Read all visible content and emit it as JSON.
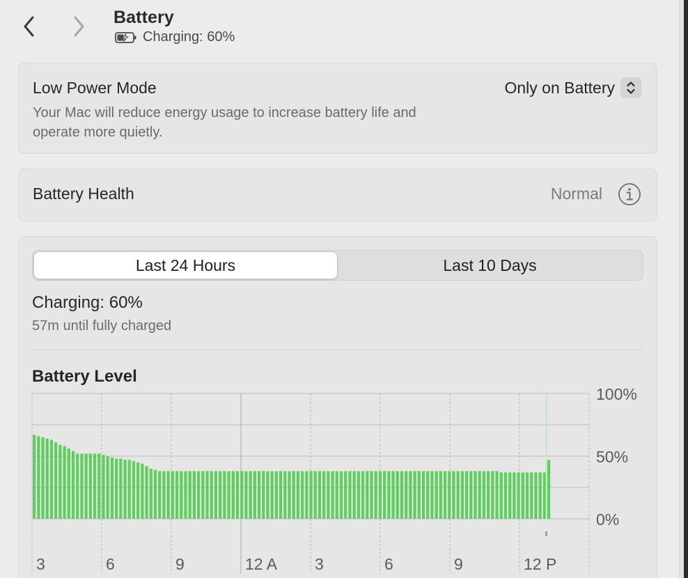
{
  "header": {
    "title": "Battery",
    "subtitle": "Charging: 60%",
    "back_icon": "chevron-left-icon",
    "forward_icon": "chevron-right-icon",
    "battery_icon": "battery-charging-icon"
  },
  "low_power_mode": {
    "title": "Low Power Mode",
    "description": "Your Mac will reduce energy usage to increase battery life and operate more quietly.",
    "selected_option": "Only on Battery"
  },
  "battery_health": {
    "label": "Battery Health",
    "value": "Normal",
    "info_icon": "info-circle-icon"
  },
  "usage": {
    "tabs": [
      {
        "label": "Last 24 Hours",
        "active": true
      },
      {
        "label": "Last 10 Days",
        "active": false
      }
    ],
    "status": "Charging: 60%",
    "time_remaining": "57m until fully charged"
  },
  "colors": {
    "bar_green": "#5fce5f",
    "charging_marker": "#bfe8bf"
  },
  "chart_data": {
    "type": "bar",
    "title": "Battery Level",
    "y_tick_labels": [
      "100%",
      "50%",
      "0%"
    ],
    "ylim": [
      0,
      100
    ],
    "x_tick_labels": [
      "3",
      "6",
      "9",
      "12 A",
      "3",
      "6",
      "9",
      "12 P"
    ],
    "grid": true,
    "values": [
      67,
      66,
      65,
      64,
      63,
      61,
      59,
      58,
      56,
      54,
      52,
      52,
      52,
      52,
      52,
      52,
      51,
      50,
      49,
      48,
      48,
      47,
      47,
      46,
      45,
      44,
      42,
      40,
      39,
      38,
      38,
      38,
      38,
      38,
      38,
      38,
      38,
      38,
      38,
      38,
      38,
      38,
      38,
      38,
      38,
      38,
      38,
      38,
      38,
      38,
      38,
      38,
      38,
      38,
      38,
      38,
      38,
      38,
      38,
      38,
      38,
      38,
      38,
      38,
      38,
      38,
      38,
      38,
      38,
      38,
      38,
      38,
      38,
      38,
      38,
      38,
      38,
      38,
      38,
      38,
      38,
      38,
      38,
      38,
      38,
      38,
      38,
      38,
      38,
      38,
      38,
      38,
      38,
      38,
      38,
      38,
      38,
      38,
      38,
      38,
      38,
      38,
      38,
      38,
      38,
      38,
      38,
      38,
      37,
      37,
      37,
      37,
      37,
      37,
      37,
      37,
      37,
      37,
      37,
      47
    ]
  }
}
